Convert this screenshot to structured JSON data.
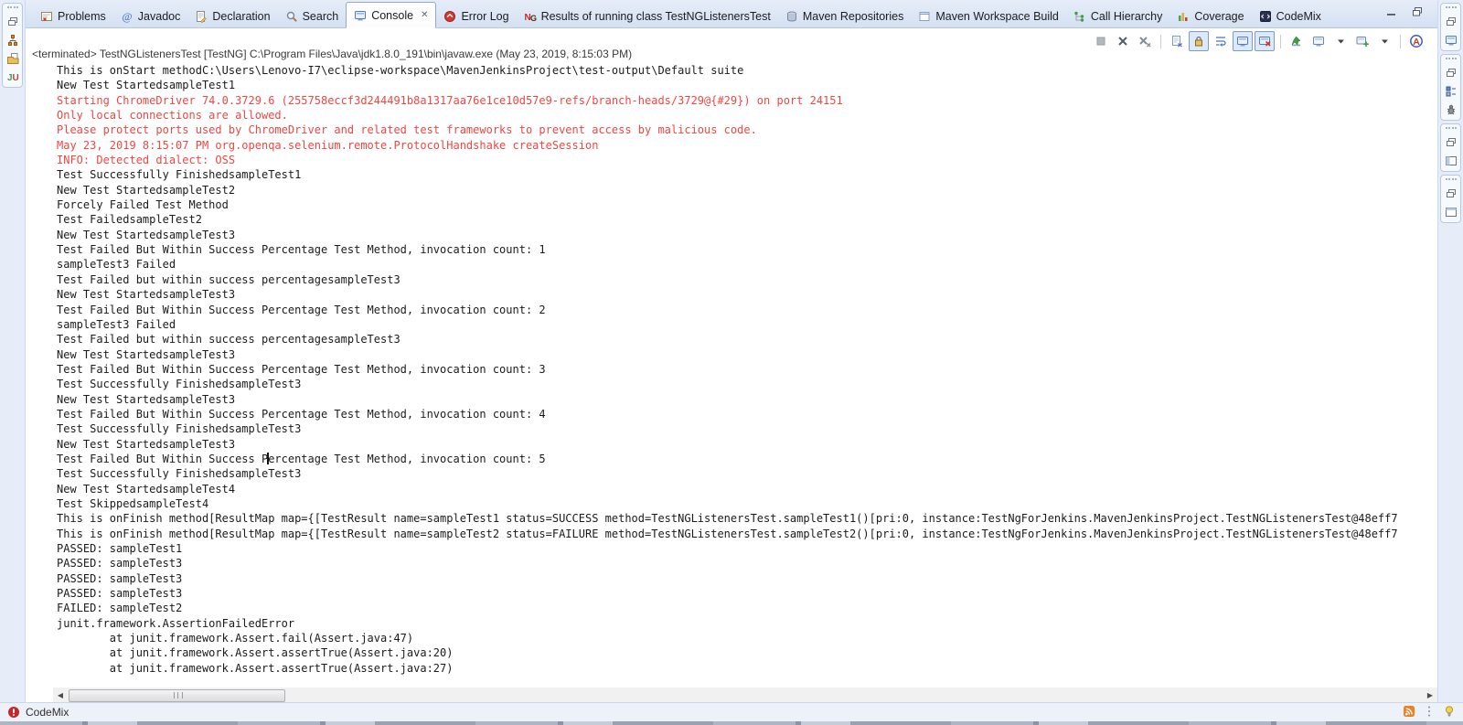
{
  "tab_bar": {
    "tabs": [
      {
        "label": "Problems",
        "icon": "problems-icon",
        "active": false
      },
      {
        "label": "Javadoc",
        "icon": "javadoc-icon",
        "active": false
      },
      {
        "label": "Declaration",
        "icon": "declaration-icon",
        "active": false
      },
      {
        "label": "Search",
        "icon": "search-icon",
        "active": false
      },
      {
        "label": "Console",
        "icon": "console-icon",
        "active": true,
        "closable": true
      },
      {
        "label": "Error Log",
        "icon": "error-log-icon",
        "active": false
      },
      {
        "label": "Results of running class TestNGListenersTest",
        "icon": "testng-icon",
        "active": false
      },
      {
        "label": "Maven Repositories",
        "icon": "maven-repo-icon",
        "active": false
      },
      {
        "label": "Maven Workspace Build",
        "icon": "maven-workspace-icon",
        "active": false
      },
      {
        "label": "Call Hierarchy",
        "icon": "call-hierarchy-icon",
        "active": false
      },
      {
        "label": "Coverage",
        "icon": "coverage-icon",
        "active": false
      },
      {
        "label": "CodeMix",
        "icon": "codemix-icon",
        "active": false
      }
    ],
    "window_buttons": [
      {
        "name": "minimize-button",
        "icon": "minimize-icon"
      },
      {
        "name": "restore-button",
        "icon": "restore-window-icon"
      }
    ]
  },
  "console_view": {
    "status_line": "<terminated> TestNGListenersTest [TestNG] C:\\Program Files\\Java\\jdk1.8.0_191\\bin\\javaw.exe (May 23, 2019, 8:15:03 PM)",
    "toolbar": [
      {
        "name": "terminate-icon"
      },
      {
        "name": "remove-launch-icon"
      },
      {
        "name": "remove-all-launches-icon"
      },
      {
        "sep": true
      },
      {
        "name": "clear-console-icon"
      },
      {
        "name": "scroll-lock-icon",
        "boxed": true
      },
      {
        "name": "word-wrap-icon"
      },
      {
        "name": "show-stdout-icon",
        "boxed": true
      },
      {
        "name": "show-stderr-icon",
        "boxed": true
      },
      {
        "sep": true
      },
      {
        "name": "pin-console-icon"
      },
      {
        "name": "display-console-icon"
      },
      {
        "name": "dropdown-caret-icon"
      },
      {
        "name": "open-console-icon"
      },
      {
        "name": "dropdown-caret-icon"
      },
      {
        "sep": true
      },
      {
        "name": "ansi-console-icon"
      }
    ]
  },
  "console": {
    "caret": {
      "line": 26,
      "col": 32
    },
    "lines": [
      {
        "t": "This is onStart methodC:\\Users\\Lenovo-I7\\eclipse-workspace\\MavenJenkinsProject\\test-output\\Default suite",
        "err": false
      },
      {
        "t": "New Test StartedsampleTest1",
        "err": false
      },
      {
        "t": "Starting ChromeDriver 74.0.3729.6 (255758eccf3d244491b8a1317aa76e1ce10d57e9-refs/branch-heads/3729@{#29}) on port 24151",
        "err": true
      },
      {
        "t": "Only local connections are allowed.",
        "err": true
      },
      {
        "t": "Please protect ports used by ChromeDriver and related test frameworks to prevent access by malicious code.",
        "err": true
      },
      {
        "t": "May 23, 2019 8:15:07 PM org.openqa.selenium.remote.ProtocolHandshake createSession",
        "err": true
      },
      {
        "t": "INFO: Detected dialect: OSS",
        "err": true
      },
      {
        "t": "Test Successfully FinishedsampleTest1",
        "err": false
      },
      {
        "t": "New Test StartedsampleTest2",
        "err": false
      },
      {
        "t": "Forcely Failed Test Method",
        "err": false
      },
      {
        "t": "Test FailedsampleTest2",
        "err": false
      },
      {
        "t": "New Test StartedsampleTest3",
        "err": false
      },
      {
        "t": "Test Failed But Within Success Percentage Test Method, invocation count: 1",
        "err": false
      },
      {
        "t": "sampleTest3 Failed",
        "err": false
      },
      {
        "t": "Test Failed but within success percentagesampleTest3",
        "err": false
      },
      {
        "t": "New Test StartedsampleTest3",
        "err": false
      },
      {
        "t": "Test Failed But Within Success Percentage Test Method, invocation count: 2",
        "err": false
      },
      {
        "t": "sampleTest3 Failed",
        "err": false
      },
      {
        "t": "Test Failed but within success percentagesampleTest3",
        "err": false
      },
      {
        "t": "New Test StartedsampleTest3",
        "err": false
      },
      {
        "t": "Test Failed But Within Success Percentage Test Method, invocation count: 3",
        "err": false
      },
      {
        "t": "Test Successfully FinishedsampleTest3",
        "err": false
      },
      {
        "t": "New Test StartedsampleTest3",
        "err": false
      },
      {
        "t": "Test Failed But Within Success Percentage Test Method, invocation count: 4",
        "err": false
      },
      {
        "t": "Test Successfully FinishedsampleTest3",
        "err": false
      },
      {
        "t": "New Test StartedsampleTest3",
        "err": false
      },
      {
        "t": "Test Failed But Within Success Percentage Test Method, invocation count: 5",
        "err": false
      },
      {
        "t": "Test Successfully FinishedsampleTest3",
        "err": false
      },
      {
        "t": "New Test StartedsampleTest4",
        "err": false
      },
      {
        "t": "Test SkippedsampleTest4",
        "err": false
      },
      {
        "t": "This is onFinish method[ResultMap map={[TestResult name=sampleTest1 status=SUCCESS method=TestNGListenersTest.sampleTest1()[pri:0, instance:TestNgForJenkins.MavenJenkinsProject.TestNGListenersTest@48eff7",
        "err": false
      },
      {
        "t": "This is onFinish method[ResultMap map={[TestResult name=sampleTest2 status=FAILURE method=TestNGListenersTest.sampleTest2()[pri:0, instance:TestNgForJenkins.MavenJenkinsProject.TestNGListenersTest@48eff7",
        "err": false
      },
      {
        "t": "PASSED: sampleTest1",
        "err": false
      },
      {
        "t": "PASSED: sampleTest3",
        "err": false
      },
      {
        "t": "PASSED: sampleTest3",
        "err": false
      },
      {
        "t": "PASSED: sampleTest3",
        "err": false
      },
      {
        "t": "FAILED: sampleTest2",
        "err": false
      },
      {
        "t": "junit.framework.AssertionFailedError",
        "err": false
      },
      {
        "t": "        at junit.framework.Assert.fail(Assert.java:47)",
        "err": false
      },
      {
        "t": "        at junit.framework.Assert.assertTrue(Assert.java:20)",
        "err": false
      },
      {
        "t": "        at junit.framework.Assert.assertTrue(Assert.java:27)",
        "err": false
      }
    ]
  },
  "left_rail": {
    "stacks": [
      [
        "restore-icon",
        "hierarchy-icon",
        "copy-folder-icon",
        "junit-icon"
      ]
    ]
  },
  "right_rail": {
    "stacks": [
      [
        "restore-icon",
        "console-icon"
      ],
      [
        "restore-icon",
        "testng-grid-icon",
        "debug-bug-icon"
      ],
      [
        "restore-icon",
        "layout-left-icon"
      ],
      [
        "restore-icon",
        "layout-top-icon"
      ]
    ]
  },
  "status_bar": {
    "left_icon": "codemix-error-icon",
    "label": "CodeMix",
    "right_icons": [
      "rss-icon",
      "overflow-dots-icon",
      "lightbulb-icon"
    ]
  },
  "colors": {
    "stderr_red": "#ee4742",
    "tabbar_blue": "#d4e1f2",
    "accent_border": "#94aac9"
  }
}
